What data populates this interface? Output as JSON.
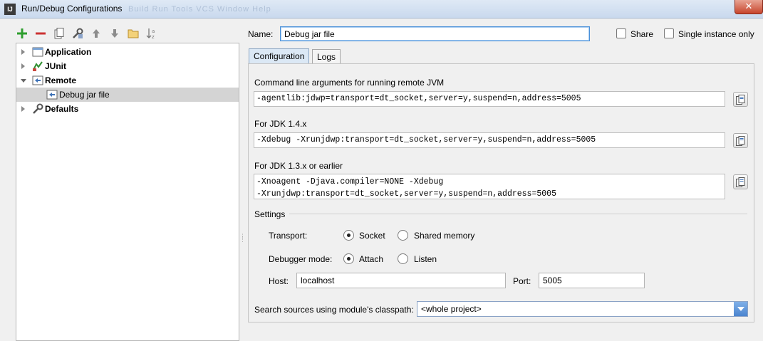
{
  "window": {
    "title": "Run/Debug Configurations",
    "app_icon": "IJ",
    "close": "✕",
    "ghost_menu": "Build  Run  Tools  VCS  Window  Help"
  },
  "toolbar": [
    "add-icon",
    "remove-icon",
    "copy-icon",
    "edit-defaults-icon",
    "move-up-icon",
    "move-down-icon",
    "folder-icon",
    "sort-icon"
  ],
  "tree": {
    "items": [
      {
        "label": "Application",
        "expanded": false,
        "bold": true
      },
      {
        "label": "JUnit",
        "expanded": false,
        "bold": true
      },
      {
        "label": "Remote",
        "expanded": true,
        "bold": true
      },
      {
        "label": "Debug jar file",
        "selected": true,
        "bold": false
      },
      {
        "label": "Defaults",
        "expanded": false,
        "bold": true
      }
    ]
  },
  "name": {
    "label": "Name:",
    "value": "Debug jar file"
  },
  "share": {
    "label": "Share",
    "checked": false
  },
  "single_instance": {
    "label": "Single instance only",
    "checked": false
  },
  "tabs": [
    {
      "label": "Configuration",
      "active": true
    },
    {
      "label": "Logs",
      "active": false
    }
  ],
  "cmd_args": {
    "label": "Command line arguments for running remote JVM",
    "value": "-agentlib:jdwp=transport=dt_socket,server=y,suspend=n,address=5005"
  },
  "jdk14": {
    "label": "For JDK 1.4.x",
    "value": "-Xdebug -Xrunjdwp:transport=dt_socket,server=y,suspend=n,address=5005"
  },
  "jdk13": {
    "label": "For JDK 1.3.x or earlier",
    "line1": "-Xnoagent -Djava.compiler=NONE -Xdebug",
    "line2": "-Xrunjdwp:transport=dt_socket,server=y,suspend=n,address=5005"
  },
  "settings": {
    "label": "Settings",
    "transport": {
      "label": "Transport:",
      "options": [
        {
          "label": "Socket",
          "selected": true
        },
        {
          "label": "Shared memory",
          "selected": false
        }
      ]
    },
    "debugger_mode": {
      "label": "Debugger mode:",
      "options": [
        {
          "label": "Attach",
          "selected": true
        },
        {
          "label": "Listen",
          "selected": false
        }
      ]
    },
    "host": {
      "label": "Host:",
      "value": "localhost"
    },
    "port": {
      "label": "Port:",
      "value": "5005"
    }
  },
  "classpath": {
    "label": "Search sources using module's classpath:",
    "value": "<whole project>"
  },
  "colors": {
    "accent": "#4a90d9",
    "selection": "#d4d4d4",
    "add_green": "#2e9e2e",
    "remove_red": "#cc3333"
  }
}
